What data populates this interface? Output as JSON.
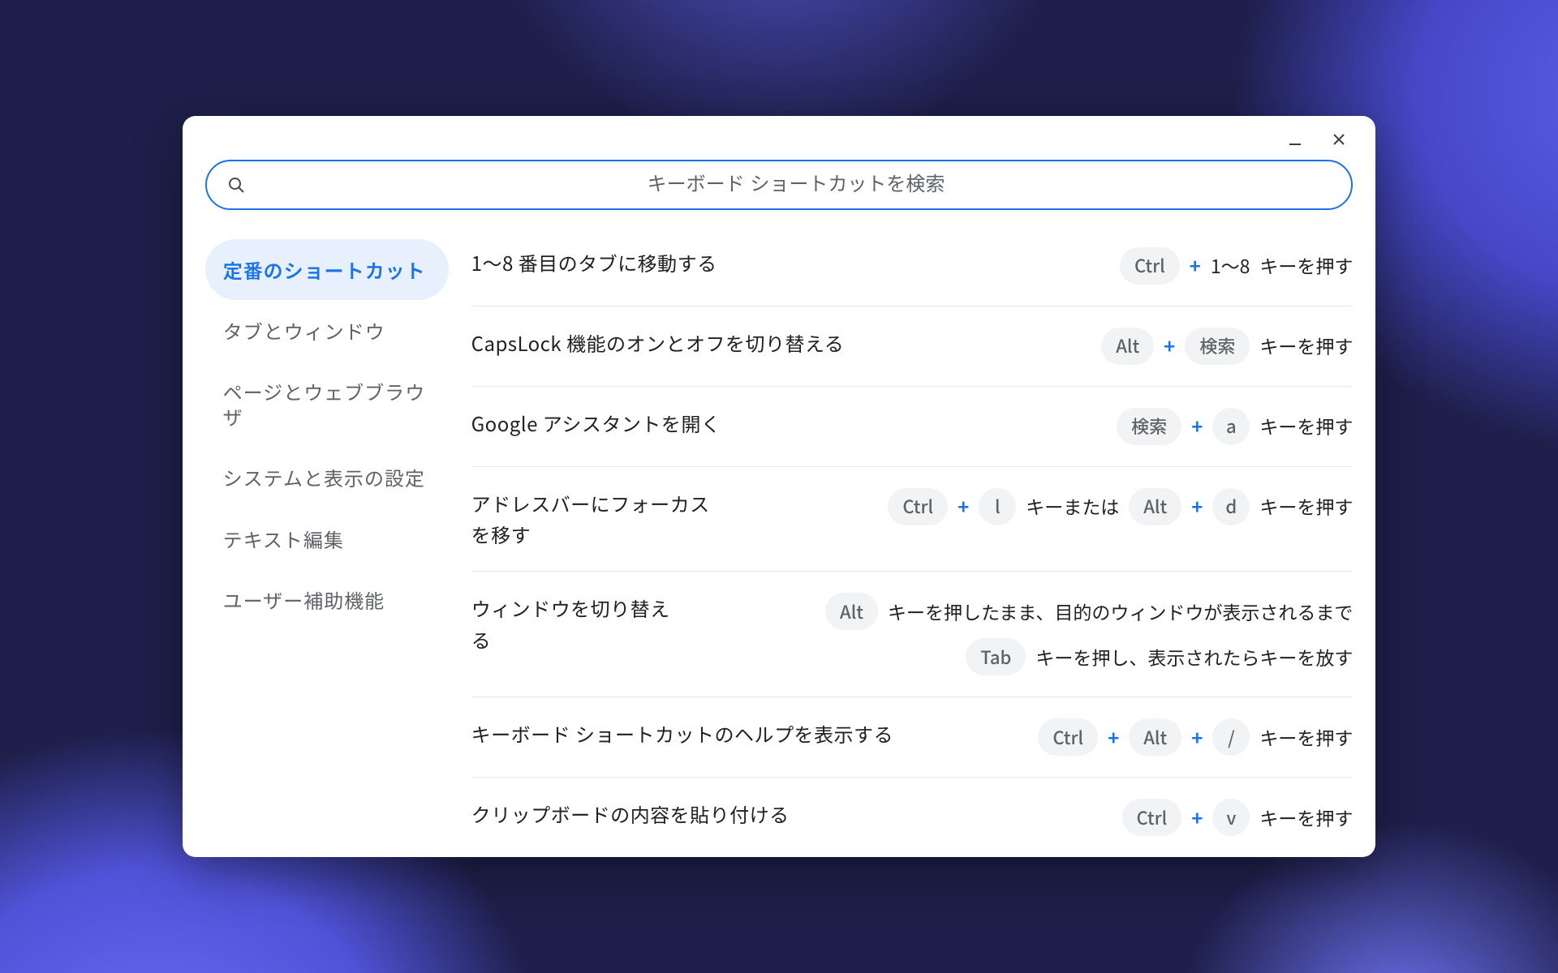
{
  "search": {
    "placeholder": "キーボード ショートカットを検索"
  },
  "sidebar": {
    "items": [
      {
        "label": "定番のショートカット",
        "active": true
      },
      {
        "label": "タブとウィンドウ"
      },
      {
        "label": "ページとウェブブラウザ"
      },
      {
        "label": "システムと表示の設定"
      },
      {
        "label": "テキスト編集"
      },
      {
        "label": "ユーザー補助機能"
      }
    ]
  },
  "strings": {
    "plus": "+",
    "press_key": "キーを押す",
    "key_or": "キーまたは"
  },
  "rows": [
    {
      "label": "1〜8 番目のタブに移動する",
      "keys": {
        "k1": "Ctrl",
        "t1": "1〜8"
      }
    },
    {
      "label": "CapsLock 機能のオンとオフを切り替える",
      "keys": {
        "k1": "Alt",
        "k2": "検索"
      }
    },
    {
      "label": "Google アシスタントを開く",
      "keys": {
        "k1": "検索",
        "k2": "a"
      }
    },
    {
      "label": "アドレスバーにフォーカスを移す",
      "keys": {
        "k1": "Ctrl",
        "k2": "l",
        "k3": "Alt",
        "k4": "d"
      }
    },
    {
      "label": "ウィンドウを切り替える",
      "keys": {
        "k1": "Alt",
        "t1": "キーを押したまま、目的のウィンドウが表示されるまで",
        "k2": "Tab",
        "t2": "キーを押し、表示されたらキーを放す"
      }
    },
    {
      "label": "キーボード ショートカットのヘルプを表示する",
      "keys": {
        "k1": "Ctrl",
        "k2": "Alt",
        "k3": "/"
      }
    },
    {
      "label": "クリップボードの内容を貼り付ける",
      "keys": {
        "k1": "Ctrl",
        "k2": "v"
      }
    }
  ]
}
